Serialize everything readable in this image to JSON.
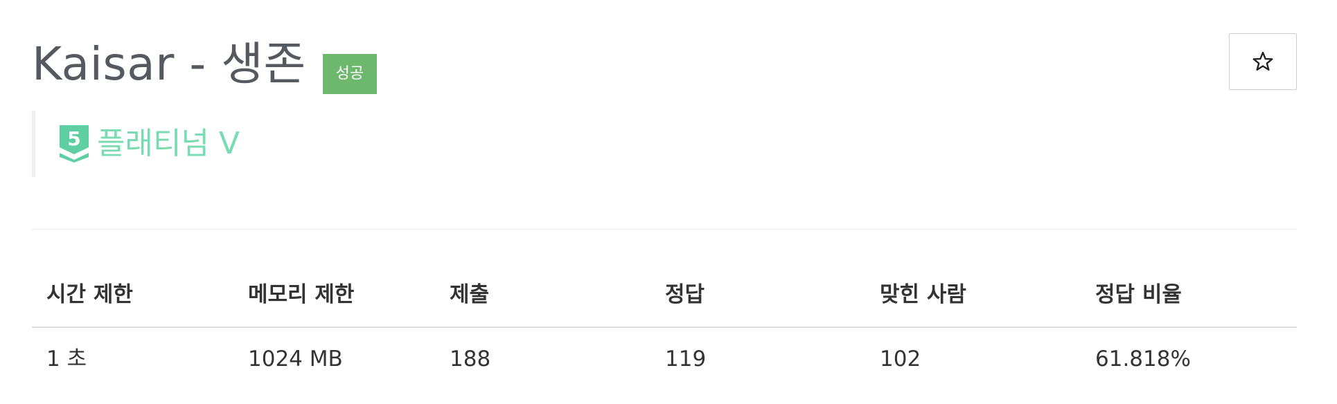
{
  "problem": {
    "title": "Kaisar - 생존",
    "result_badge": "성공",
    "result_color": "#6db86d"
  },
  "star_button": {
    "icon": "star-outline-icon"
  },
  "tier": {
    "icon": "platinum-tier-shield-icon",
    "level_number": "5",
    "label": "플래티넘 V",
    "color": "#79dbb1"
  },
  "stats": {
    "headers": [
      "시간 제한",
      "메모리 제한",
      "제출",
      "정답",
      "맞힌 사람",
      "정답 비율"
    ],
    "values": [
      "1 초",
      "1024 MB",
      "188",
      "119",
      "102",
      "61.818%"
    ]
  }
}
